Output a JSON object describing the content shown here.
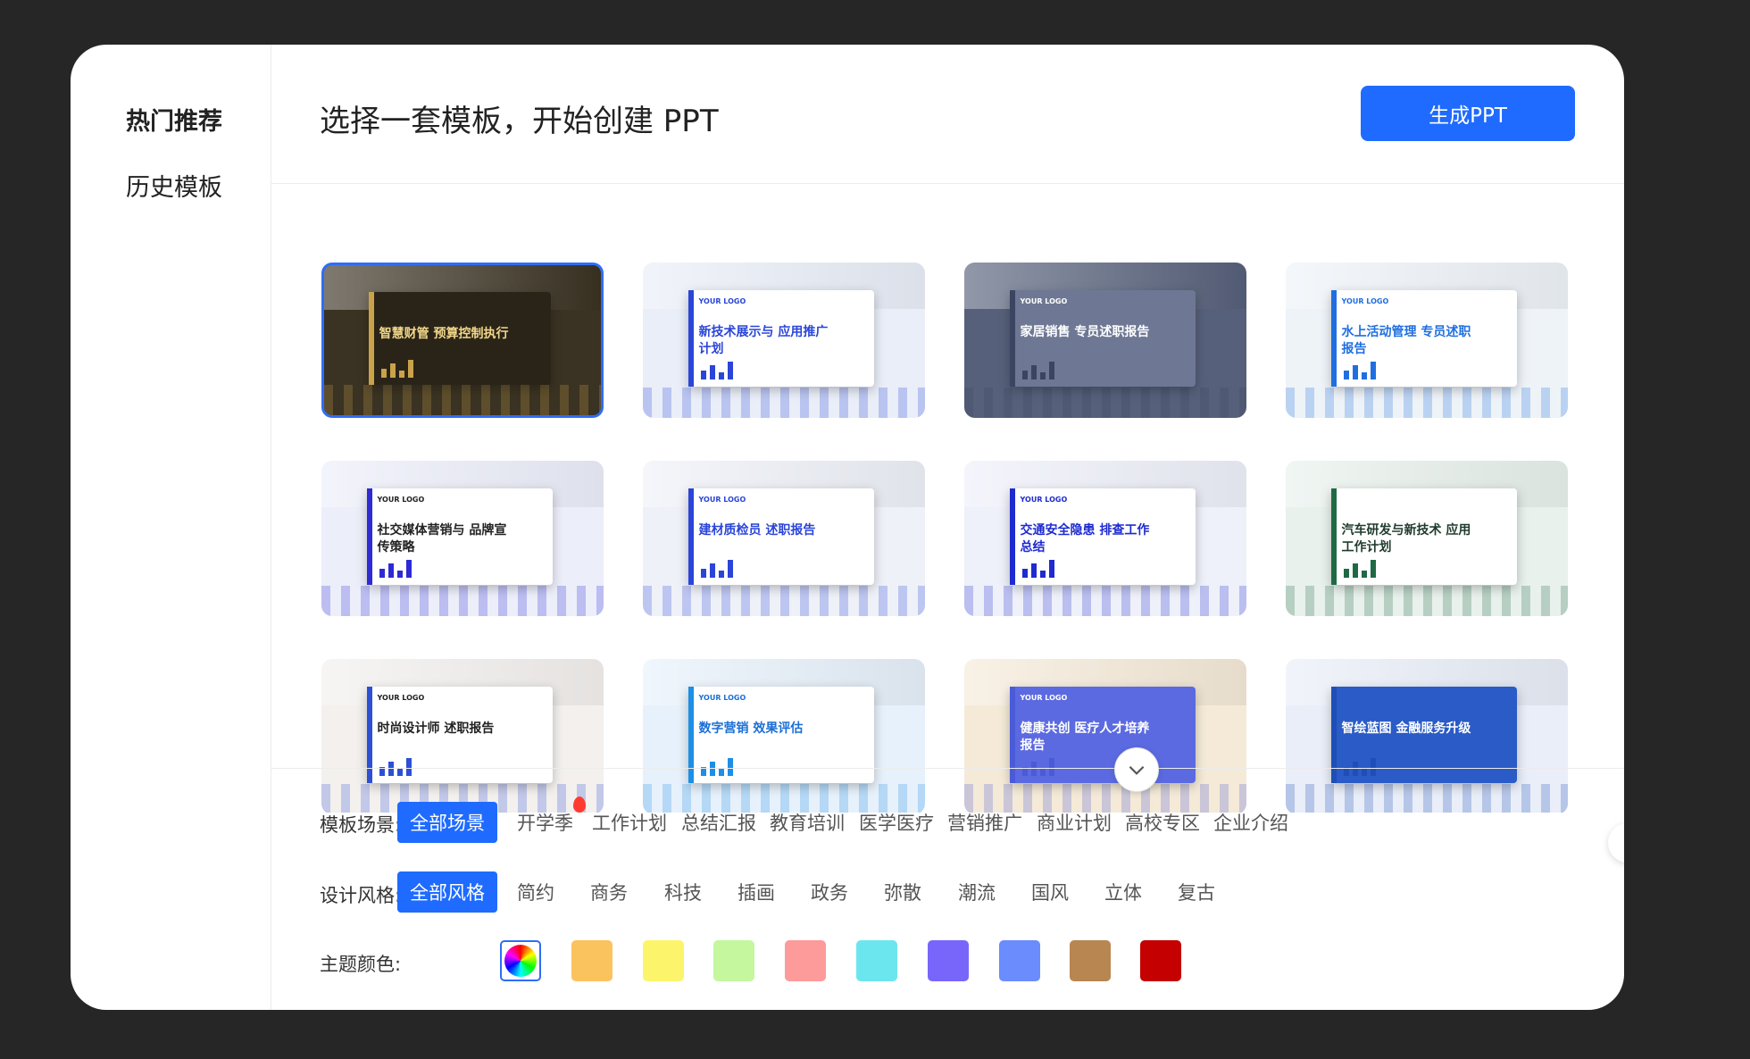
{
  "sidebar": {
    "items": [
      {
        "label": "热门推荐",
        "active": true
      },
      {
        "label": "历史模板",
        "active": false
      }
    ]
  },
  "header": {
    "title": "选择一套模板，开始创建 PPT",
    "generate_label": "生成PPT"
  },
  "templates": [
    {
      "title": "智慧财管 预算控制执行",
      "logo": "",
      "bg": "#3a3222",
      "accent": "#c9a24a",
      "text": "#f1d78a",
      "slide": "#2a2418",
      "selected": true
    },
    {
      "title": "新技术展示与 应用推广计划",
      "logo": "YOUR LOGO",
      "bg": "#e9eef8",
      "accent": "#2a45d8",
      "text": "#2a45d8",
      "slide": "#ffffff",
      "selected": false
    },
    {
      "title": "家居销售 专员述职报告",
      "logo": "YOUR LOGO",
      "bg": "#56607a",
      "accent": "#3b4460",
      "text": "#ffffff",
      "slide": "#6e7894",
      "selected": false
    },
    {
      "title": "水上活动管理 专员述职报告",
      "logo": "YOUR LOGO",
      "bg": "#eef3f8",
      "accent": "#1f6fe0",
      "text": "#1f6fe0",
      "slide": "#ffffff",
      "selected": false
    },
    {
      "title": "社交媒体营销与 品牌宣传策略",
      "logo": "YOUR LOGO",
      "bg": "#eceefa",
      "accent": "#2d2ad6",
      "text": "#222222",
      "slide": "#ffffff",
      "selected": false
    },
    {
      "title": "建材质检员 述职报告",
      "logo": "YOUR LOGO",
      "bg": "#eef1f8",
      "accent": "#2a45d8",
      "text": "#2a45d8",
      "slide": "#ffffff",
      "selected": false
    },
    {
      "title": "交通安全隐患 排查工作总结",
      "logo": "YOUR LOGO",
      "bg": "#eef0fa",
      "accent": "#1e2bd0",
      "text": "#1e2bd0",
      "slide": "#ffffff",
      "selected": false
    },
    {
      "title": "汽车研发与新技术 应用工作计划",
      "logo": "",
      "bg": "#e8f1ec",
      "accent": "#1f6a44",
      "text": "#1f3b2c",
      "slide": "#ffffff",
      "selected": false
    },
    {
      "title": "时尚设计师 述职报告",
      "logo": "YOUR LOGO",
      "bg": "#f3f0ee",
      "accent": "#2d4fd6",
      "text": "#222222",
      "slide": "#ffffff",
      "selected": false
    },
    {
      "title": "数字营销 效果评估",
      "logo": "YOUR LOGO",
      "bg": "#e7f1fb",
      "accent": "#1c8fe6",
      "text": "#1c6fd6",
      "slide": "#ffffff",
      "selected": false
    },
    {
      "title": "健康共创 医疗人才培养报告",
      "logo": "YOUR LOGO",
      "bg": "#f5ead8",
      "accent": "#4a5bd8",
      "text": "#ffffff",
      "slide": "#5b6ae0",
      "selected": false
    },
    {
      "title": "智绘蓝图 金融服务升级",
      "logo": "",
      "bg": "#e9eef8",
      "accent": "#1e4fb8",
      "text": "#ffffff",
      "slide": "#2a5bc6",
      "selected": false
    }
  ],
  "filters": {
    "scene": {
      "label": "模板场景:",
      "options": [
        "全部场景",
        "开学季",
        "工作计划",
        "总结汇报",
        "教育培训",
        "医学医疗",
        "营销推广",
        "商业计划",
        "高校专区",
        "企业介绍"
      ],
      "active": 0,
      "hot": 1
    },
    "style": {
      "label": "设计风格:",
      "options": [
        "全部风格",
        "简约",
        "商务",
        "科技",
        "插画",
        "政务",
        "弥散",
        "潮流",
        "国风",
        "立体",
        "复古"
      ],
      "active": 0
    },
    "color": {
      "label": "主题颜色:",
      "swatches": [
        "all",
        "#fbc35e",
        "#fcf56b",
        "#c4f79e",
        "#fd9a9a",
        "#6ce6ee",
        "#7866fb",
        "#6a8cfd",
        "#b88651",
        "#c40000"
      ],
      "selected": 0
    }
  },
  "icons": {
    "scroll_down": "chevron-down-icon",
    "next": "chevron-right-icon"
  }
}
